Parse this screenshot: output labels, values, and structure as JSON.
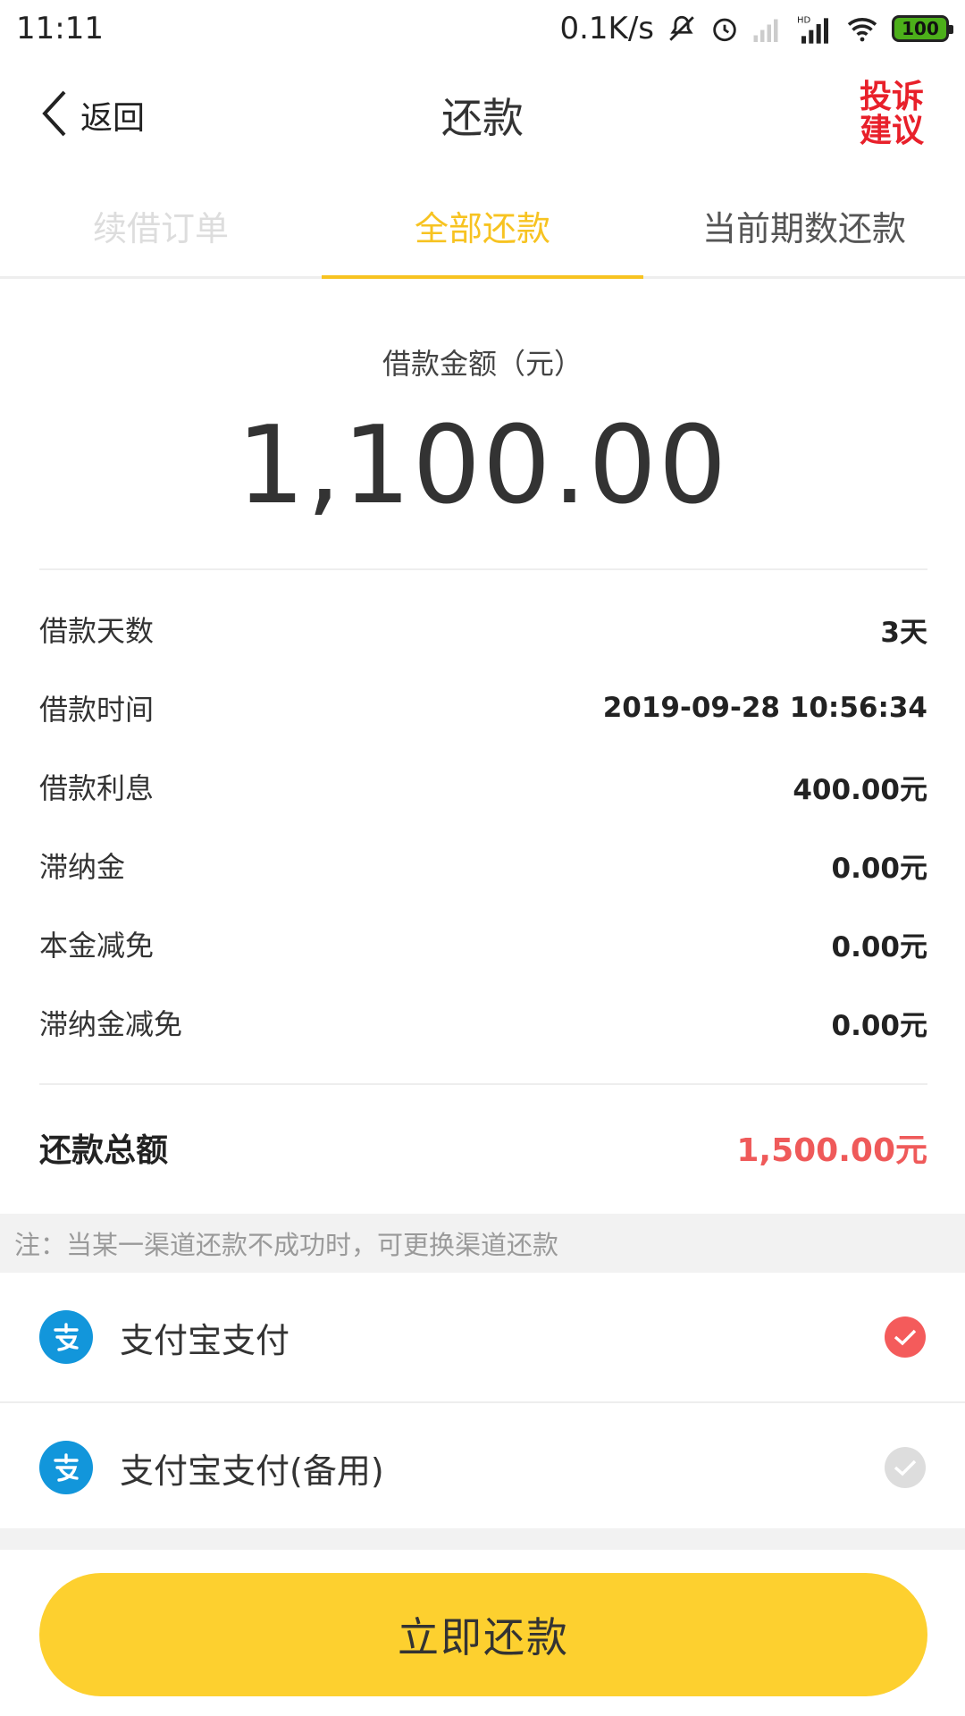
{
  "status_bar": {
    "time": "11:11",
    "net_speed": "0.1K/s",
    "battery": "100",
    "icons": [
      "mute-icon",
      "alarm-icon",
      "signal-icon",
      "hd-signal-icon",
      "wifi-icon",
      "battery-icon"
    ]
  },
  "nav": {
    "back_label": "返回",
    "title": "还款",
    "complaint_line1": "投诉",
    "complaint_line2": "建议"
  },
  "tabs": [
    {
      "label": "续借订单",
      "state": "disabled"
    },
    {
      "label": "全部还款",
      "state": "active"
    },
    {
      "label": "当前期数还款",
      "state": "inactive"
    }
  ],
  "amount": {
    "label": "借款金额（元）",
    "value": "1,100.00"
  },
  "details": [
    {
      "label": "借款天数",
      "value": "3天"
    },
    {
      "label": "借款时间",
      "value": "2019-09-28 10:56:34"
    },
    {
      "label": "借款利息",
      "value": "400.00元"
    },
    {
      "label": "滞纳金",
      "value": "0.00元"
    },
    {
      "label": "本金减免",
      "value": "0.00元"
    },
    {
      "label": "滞纳金减免",
      "value": "0.00元"
    }
  ],
  "total": {
    "label": "还款总额",
    "value": "1,500.00元"
  },
  "note": "注：当某一渠道还款不成功时，可更换渠道还款",
  "payment_options": [
    {
      "label": "支付宝支付",
      "selected": true,
      "icon": "alipay-icon"
    },
    {
      "label": "支付宝支付(备用)",
      "selected": false,
      "icon": "alipay-icon"
    }
  ],
  "submit_label": "立即还款",
  "colors": {
    "accent": "#f7c321",
    "button": "#fdd02f",
    "total": "#ef5a5a",
    "complaint": "#e8202a",
    "alipay": "#1296db"
  }
}
